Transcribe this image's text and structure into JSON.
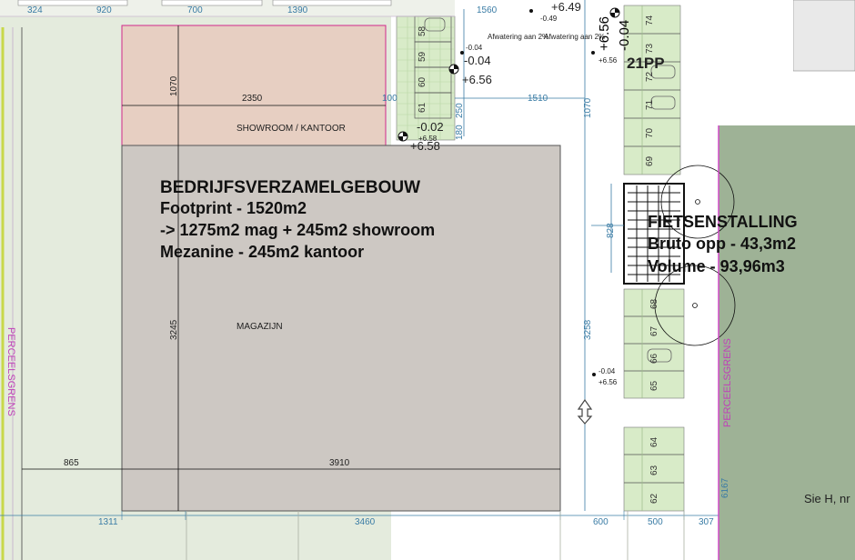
{
  "building": {
    "title": "BEDRIJFSVERZAMELGEBOUW",
    "line1": "Footprint - 1520m2",
    "line2": " -> 1275m2 mag + 245m2 showroom",
    "line3": "Mezanine - 245m2 kantoor",
    "showroom_label": "SHOWROOM / KANTOOR",
    "storage_label": "MAGAZIJN"
  },
  "bike": {
    "title": "FIETSENSTALLING",
    "line1": "Bruto opp - 43,3m2",
    "line2": "Volume - 93,96m3"
  },
  "parking": {
    "count_label": "21PP",
    "top_spots": [
      "58",
      "59",
      "60",
      "61"
    ],
    "right_top_spots": [
      "74",
      "73",
      "72",
      "71",
      "70",
      "69"
    ],
    "right_mid_spots": [
      "68",
      "67",
      "66",
      "65"
    ],
    "right_bottom_spots": [
      "64",
      "63",
      "62"
    ]
  },
  "boundary": {
    "left": "PERCEELSGRENS",
    "right": "PERCEELSGRENS"
  },
  "neighbor": "Sie H, nr",
  "slope": {
    "left": "Afwatering aan 2%",
    "right": "Afwatering aan 2%"
  },
  "dimensions": {
    "top_324": "324",
    "top_920": "920",
    "top_700": "700",
    "top_1390": "1390",
    "top_1560": "1560",
    "h_2350": "2350",
    "h_1510": "1510",
    "h_100": "100",
    "v_1070_left": "1070",
    "v_1070_right": "1070",
    "v_3245": "3245",
    "v_3258": "3258",
    "v_828": "828",
    "v_6167": "6167",
    "v_250": "250",
    "v_180": "180",
    "h_865": "865",
    "h_3910": "3910",
    "b_1311": "1311",
    "b_3460": "3460",
    "b_600": "600",
    "b_500": "500",
    "b_307": "307"
  },
  "levels": {
    "l1_minus": "-0.04",
    "l1_plus": "+6.56",
    "l2_minus": "-0.04",
    "l2_plus": "+6.56",
    "l3_minus": "-0.02",
    "l3_plus": "+6.58",
    "l4_minus": "-0.04",
    "l4_plus": "+6.56",
    "l5_minus": "-0.04",
    "l5_plus": "+6.56",
    "top_minus": "-0.06",
    "top_plus": "+6.49",
    "top_small": "-0.49",
    "small_004": "-0.04",
    "small_656": "+6.56",
    "small_698": "+6.58"
  },
  "colors": {
    "building_fill": "#cdc8c3",
    "showroom_fill": "#e7cfc2",
    "grass": "#e4ebdd",
    "parking_green": "#d8ebc8",
    "right_field": "#9eb296",
    "boundary_pink": "#d040c8",
    "dim_blue": "#3a7ca5"
  }
}
